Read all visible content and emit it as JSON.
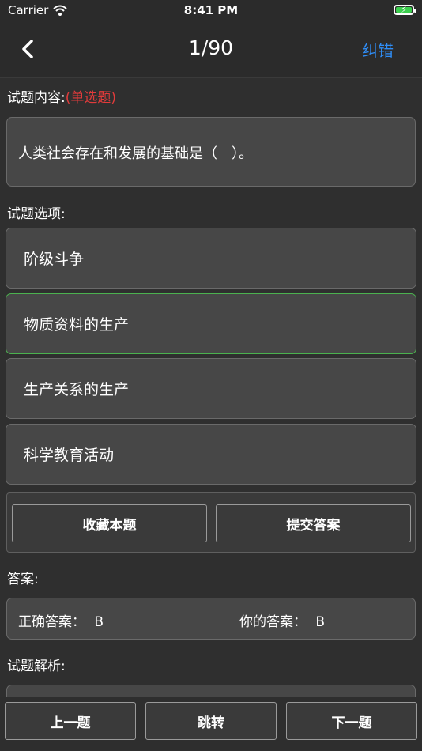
{
  "status": {
    "carrier": "Carrier",
    "time": "8:41 PM"
  },
  "nav": {
    "title": "1/90",
    "right_label": "纠错"
  },
  "question": {
    "section_label": "试题内容:",
    "type_label": "(单选题)",
    "text": "人类社会存在和发展的基础是（　）。"
  },
  "options": {
    "section_label": "试题选项:",
    "items": [
      {
        "label": "阶级斗争"
      },
      {
        "label": "物质资料的生产"
      },
      {
        "label": "生产关系的生产"
      },
      {
        "label": "科学教育活动"
      }
    ]
  },
  "actions": {
    "favorite": "收藏本题",
    "submit": "提交答案"
  },
  "answer": {
    "section_label": "答案:",
    "correct_label": "正确答案：",
    "correct_value": "B",
    "yours_label": "你的答案：",
    "yours_value": "B"
  },
  "analysis": {
    "section_label": "试题解析:"
  },
  "footer": {
    "prev": "上一题",
    "jump": "跳转",
    "next": "下一题"
  },
  "colors": {
    "accent": "#2f8df6",
    "selected_border": "#4bb24f",
    "type_red": "#e23b3b",
    "battery": "#3ccf4e"
  }
}
